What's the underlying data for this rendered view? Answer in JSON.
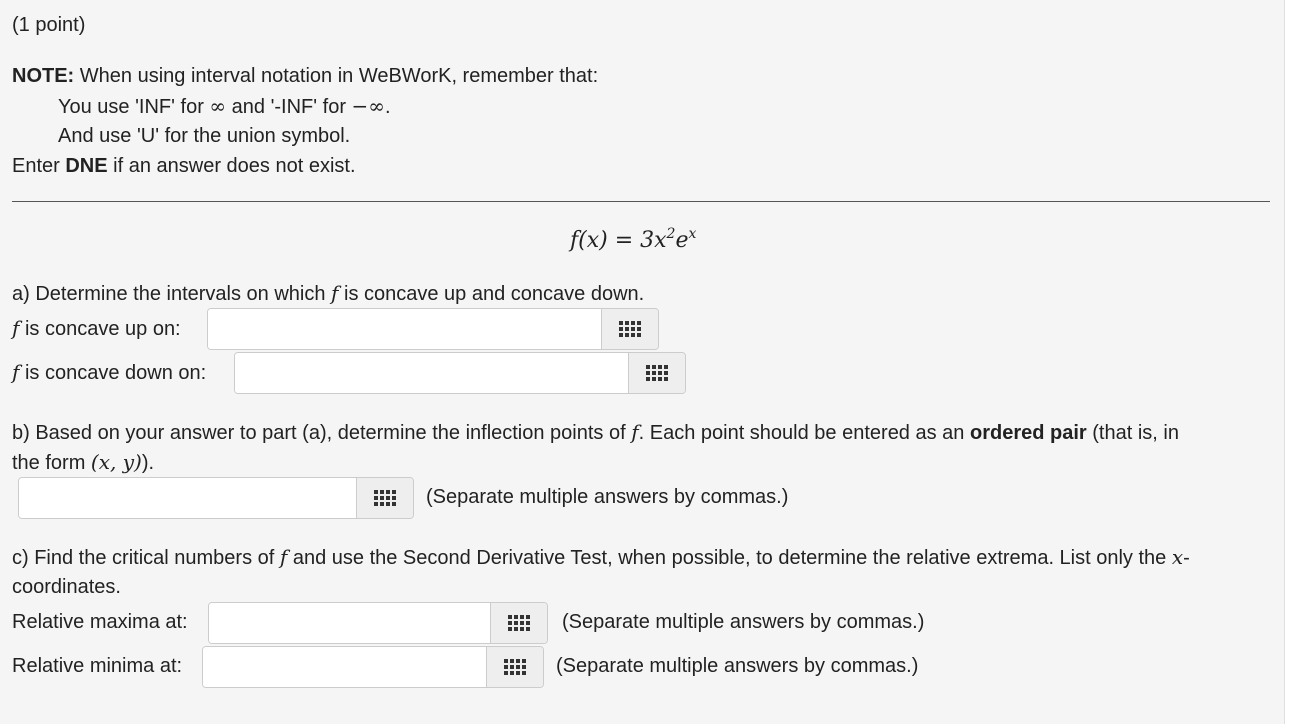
{
  "points_label": "(1 point)",
  "note": {
    "heading": "NOTE:",
    "intro": " When using interval notation in WeBWorK, remember that:",
    "line1_pre": "You use 'INF' for ",
    "infinity": "∞",
    "line1_mid": " and '-INF' for ",
    "neg_infinity": "−∞",
    "line1_end": ".",
    "line2": "And use 'U' for the union symbol.",
    "enter_pre": "Enter ",
    "dne": "DNE",
    "enter_post": " if an answer does not exist."
  },
  "function": {
    "lhs": "f(x) = 3x",
    "exp": "2",
    "e": "e",
    "e_exp": "x"
  },
  "part_a": {
    "prompt_pre": "a) Determine the intervals on which ",
    "f": "f",
    "prompt_post": " is concave up and concave down.",
    "up_label": " is concave up on:",
    "down_label": " is concave down on:",
    "up_value": "",
    "down_value": ""
  },
  "part_b": {
    "prompt_pre": "b) Based on your answer to part (a), determine the inflection points of ",
    "prompt_mid": ". Each point should be entered as an ",
    "ordered_pair": "ordered pair",
    "prompt_post": " (that is, in",
    "line2_pre": "the form ",
    "form": "(x, y)",
    "line2_post": ").",
    "hint": "(Separate multiple answers by commas.)",
    "value": ""
  },
  "part_c": {
    "prompt_pre": "c) Find the critical numbers of ",
    "prompt_post": " and use the Second Derivative Test, when possible, to determine the relative extrema. List only the ",
    "x": "x",
    "dash": "-",
    "line2": "coordinates.",
    "max_label": "Relative maxima at:",
    "min_label": "Relative minima at:",
    "hint": "(Separate multiple answers by commas.)",
    "max_value": "",
    "min_value": ""
  },
  "icons": {
    "equation_editor": "equation-editor-grid-icon"
  }
}
